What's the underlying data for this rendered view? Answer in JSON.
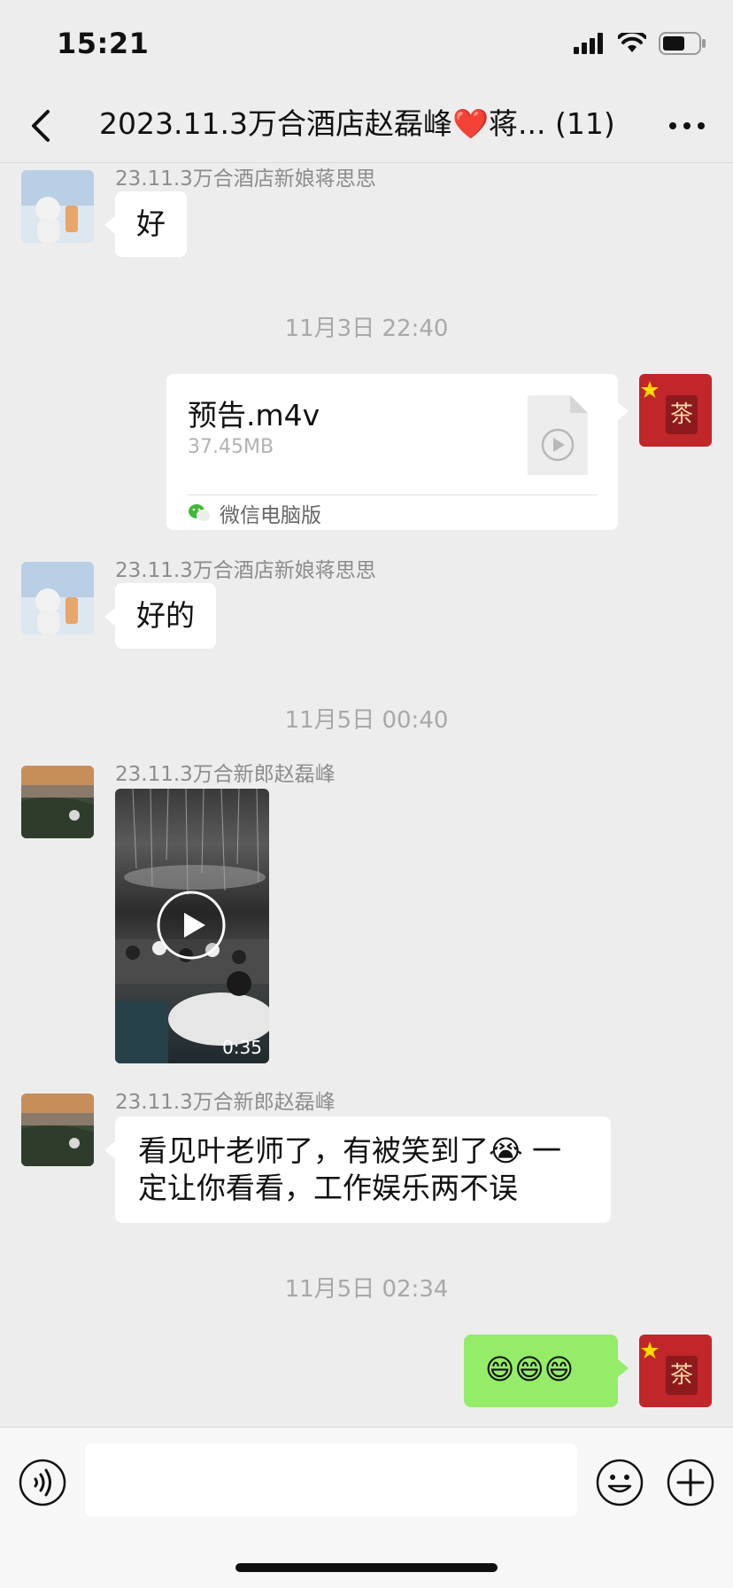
{
  "status": {
    "time": "15:21"
  },
  "nav": {
    "title": "2023.11.3万合酒店赵磊峰❤️蒋... (11)"
  },
  "messages": [
    {
      "sender": "23.11.3万合酒店新娘蒋思思",
      "text": "好"
    },
    {
      "timestamp": "11月3日 22:40"
    },
    {
      "file": {
        "name": "预告.m4v",
        "size": "37.45MB",
        "source": "微信电脑版"
      }
    },
    {
      "sender": "23.11.3万合酒店新娘蒋思思",
      "text": "好的"
    },
    {
      "timestamp": "11月5日 00:40"
    },
    {
      "sender": "23.11.3万合新郎赵磊峰",
      "video": {
        "duration": "0:35"
      }
    },
    {
      "sender": "23.11.3万合新郎赵磊峰",
      "text_line1": "看见叶老师了，有被笑到了😭 一",
      "text_line2": "定让你看看，工作娱乐两不误"
    },
    {
      "timestamp": "11月5日 02:34"
    },
    {
      "text": "😄😄😄"
    }
  ],
  "input": {
    "placeholder": ""
  },
  "colors": {
    "background": "#EDEDED",
    "self_bubble": "#95EC69",
    "other_bubble": "#FFFFFF",
    "timestamp": "#A8A8A8"
  }
}
